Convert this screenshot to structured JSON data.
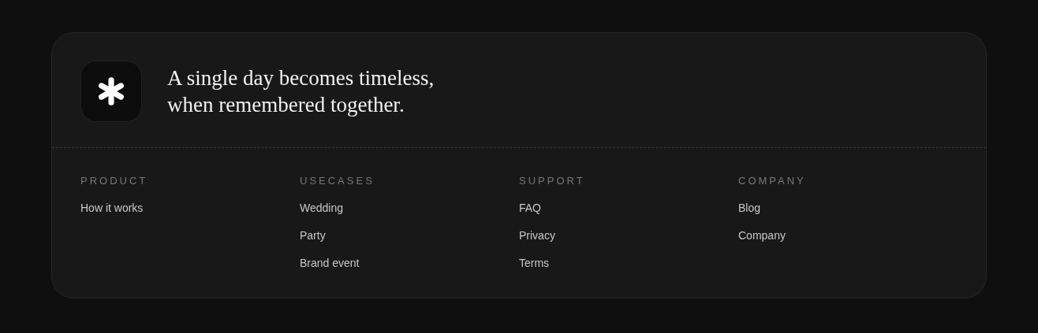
{
  "tagline": [
    "A single day becomes timeless,",
    "when remembered together."
  ],
  "columns": [
    {
      "heading": "PRODUCT",
      "links": [
        "How it works"
      ]
    },
    {
      "heading": "USECASES",
      "links": [
        "Wedding",
        "Party",
        "Brand event"
      ]
    },
    {
      "heading": "SUPPORT",
      "links": [
        "FAQ",
        "Privacy",
        "Terms"
      ]
    },
    {
      "heading": "COMPANY",
      "links": [
        "Blog",
        "Company"
      ]
    }
  ]
}
